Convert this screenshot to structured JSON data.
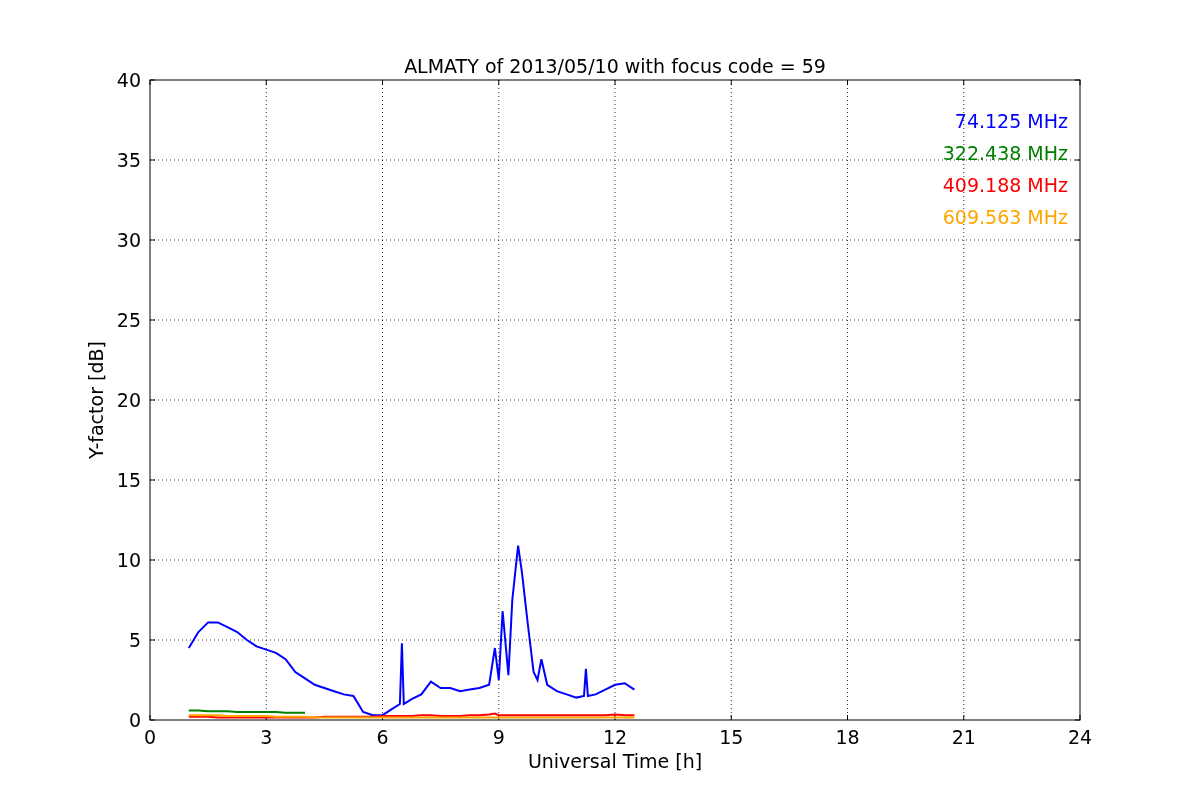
{
  "chart": {
    "chart_data": {
      "type": "line",
      "title": "ALMATY of 2013/05/10 with focus code = 59",
      "xlabel": "Universal Time [h]",
      "ylabel": "Y-factor [dB]",
      "x": [
        1.0,
        1.25,
        1.5,
        1.75,
        2.0,
        2.25,
        2.5,
        2.75,
        3.0,
        3.25,
        3.5,
        3.75,
        4.0,
        4.25,
        4.5,
        4.75,
        5.0,
        5.25,
        5.5,
        5.75,
        6.0,
        6.25,
        6.45,
        6.5,
        6.55,
        6.75,
        7.0,
        7.25,
        7.5,
        7.75,
        8.0,
        8.25,
        8.5,
        8.75,
        8.9,
        9.0,
        9.1,
        9.25,
        9.35,
        9.5,
        9.6,
        9.75,
        9.9,
        10.0,
        10.1,
        10.25,
        10.5,
        10.75,
        11.0,
        11.2,
        11.25,
        11.3,
        11.5,
        11.75,
        12.0,
        12.25,
        12.5
      ],
      "series": [
        {
          "name": "74.125 MHz",
          "color": "#0000ff",
          "values": [
            4.5,
            5.5,
            6.1,
            6.1,
            5.8,
            5.5,
            5.0,
            4.6,
            4.4,
            4.2,
            3.8,
            3.0,
            2.6,
            2.2,
            2.0,
            1.8,
            1.6,
            1.5,
            0.5,
            0.3,
            0.3,
            0.7,
            1.0,
            4.8,
            1.0,
            1.3,
            1.6,
            2.4,
            2.0,
            2.0,
            1.8,
            1.9,
            2.0,
            2.2,
            4.5,
            2.5,
            6.8,
            2.8,
            7.5,
            10.9,
            9.2,
            6.0,
            3.0,
            2.5,
            3.8,
            2.2,
            1.8,
            1.6,
            1.4,
            1.5,
            3.2,
            1.5,
            1.6,
            1.9,
            2.2,
            2.3,
            1.9
          ]
        },
        {
          "name": "322.438 MHz",
          "color": "#008000",
          "values": [
            0.6,
            0.6,
            0.55,
            0.55,
            0.55,
            0.5,
            0.5,
            0.5,
            0.5,
            0.5,
            0.45,
            0.45,
            0.45,
            null,
            null,
            null,
            null,
            null,
            null,
            null,
            null,
            null,
            null,
            null,
            null,
            null,
            null,
            null,
            null,
            null,
            null,
            null,
            null,
            null,
            null,
            null,
            null,
            null,
            null,
            null,
            null,
            null,
            null,
            null,
            null,
            null,
            null,
            null,
            null,
            null,
            null,
            null,
            null,
            null,
            null,
            null,
            null
          ]
        },
        {
          "name": "409.188 MHz",
          "color": "#ff0000",
          "values": [
            0.2,
            0.2,
            0.2,
            0.15,
            0.15,
            0.15,
            0.15,
            0.15,
            0.15,
            0.15,
            0.15,
            0.15,
            0.15,
            0.15,
            0.2,
            0.2,
            0.2,
            0.2,
            0.2,
            0.2,
            0.25,
            0.25,
            0.25,
            0.25,
            0.25,
            0.25,
            0.3,
            0.3,
            0.25,
            0.25,
            0.25,
            0.3,
            0.3,
            0.35,
            0.4,
            0.3,
            0.3,
            0.3,
            0.3,
            0.3,
            0.3,
            0.3,
            0.3,
            0.3,
            0.3,
            0.3,
            0.3,
            0.3,
            0.3,
            0.3,
            0.3,
            0.3,
            0.3,
            0.3,
            0.35,
            0.3,
            0.3
          ]
        },
        {
          "name": "609.563 MHz",
          "color": "#ffa500",
          "values": [
            0.3,
            0.3,
            0.3,
            0.3,
            0.25,
            0.25,
            0.25,
            0.25,
            0.25,
            0.2,
            0.2,
            0.2,
            0.2,
            0.15,
            0.15,
            0.15,
            0.15,
            0.15,
            0.15,
            0.15,
            0.15,
            0.15,
            0.15,
            0.15,
            0.15,
            0.15,
            0.15,
            0.15,
            0.15,
            0.15,
            0.15,
            0.15,
            0.15,
            0.15,
            0.15,
            0.15,
            0.15,
            0.15,
            0.15,
            0.15,
            0.15,
            0.15,
            0.15,
            0.15,
            0.15,
            0.15,
            0.15,
            0.15,
            0.15,
            0.15,
            0.15,
            0.15,
            0.15,
            0.15,
            0.15,
            0.15,
            0.15
          ]
        }
      ],
      "grid": true,
      "xlim": [
        0,
        24
      ],
      "ylim": [
        0,
        40
      ],
      "xticks": [
        0,
        3,
        6,
        9,
        12,
        15,
        18,
        21,
        24
      ],
      "yticks": [
        0,
        5,
        10,
        15,
        20,
        25,
        30,
        35,
        40
      ]
    }
  }
}
